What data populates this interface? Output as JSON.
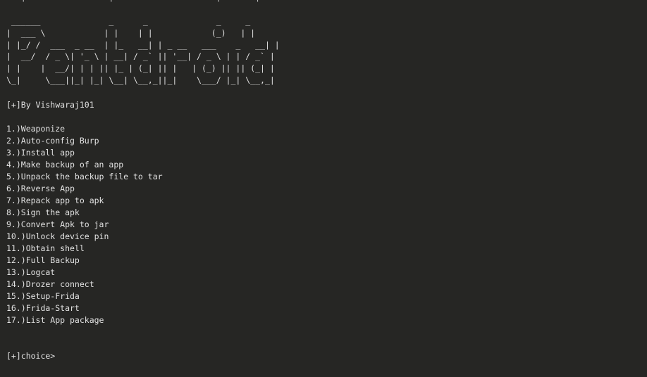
{
  "terminal": {
    "top_cut_line": "‾‾‾|‾‾‾‾‾‾‾‾‾‾‾‾‾‾‾‾‾|‾‾‾‾‾‾‾‾‾‾‾‾‾‾‾‾‾‾‾‾‾|‾‾‾‾‾‾‾|‾‾",
    "banner_art": " ______              _      _              _     _ \n|  ___ \\            | |    | |            (_)   | |\n| |_/ /  ___  _ __  | |_   __| | _ __   ___    _   __| |\n|  __/  / _ \\| '_ \\ | __| / _` || '__| / _ \\ | | / _` |\n| |    |  __/| | | || |_ | (_| || |   | (_) || || (_| |\n\\_|     \\___||_| |_| \\__| \\__,_||_|    \\___/ |_| \\__,_|",
    "author_line": "[+]By Vishwaraj101",
    "menu_items": [
      "1.)Weaponize",
      "2.)Auto-config Burp",
      "3.)Install app",
      "4.)Make backup of an app",
      "5.)Unpack the backup file to tar",
      "6.)Reverse App",
      "7.)Repack app to apk",
      "8.)Sign the apk",
      "9.)Convert Apk to jar",
      "10.)Unlock device pin",
      "11.)Obtain shell",
      "12.)Full Backup",
      "13.)Logcat",
      "14.)Drozer connect",
      "15.)Setup-Frida",
      "16.)Frida-Start",
      "17.)List App package"
    ],
    "prompt": "[+]choice>",
    "background_color": "#262624",
    "text_color": "#e2e2e2"
  }
}
